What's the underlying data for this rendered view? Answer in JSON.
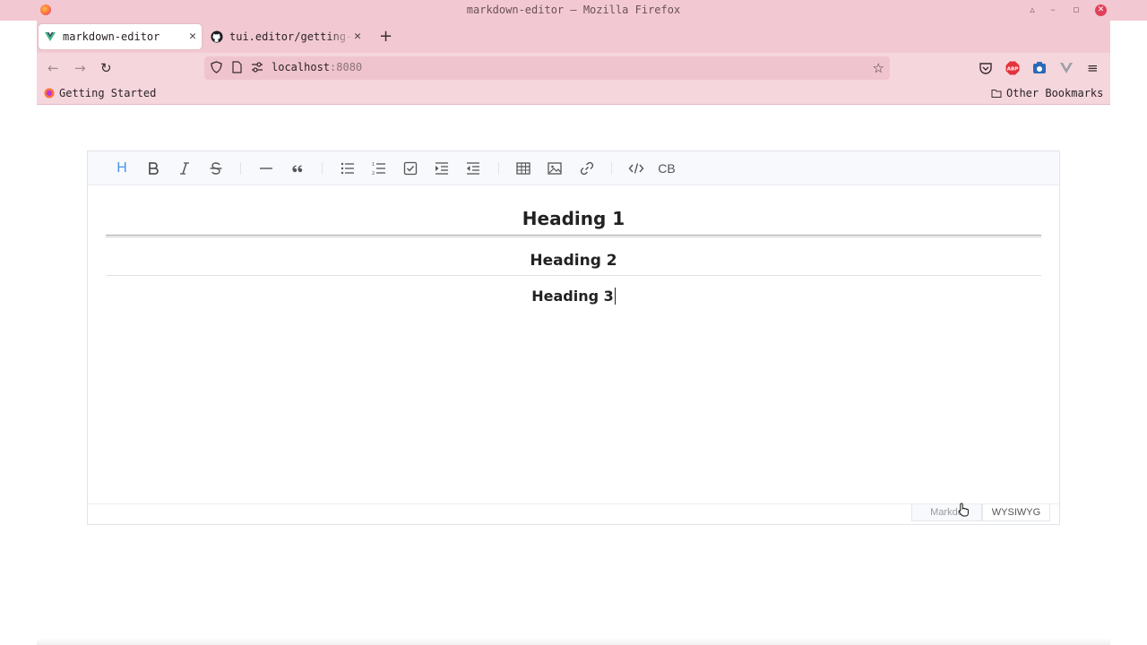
{
  "window": {
    "title": "markdown-editor — Mozilla Firefox"
  },
  "tabs": [
    {
      "label": "markdown-editor",
      "active": true,
      "favicon": "vue-icon"
    },
    {
      "label": "tui.editor/getting-started",
      "active": false,
      "favicon": "github-icon"
    }
  ],
  "navbar": {
    "url_host": "localhost",
    "url_port": ":8080"
  },
  "bookmarks": {
    "left": "Getting Started",
    "right": "Other Bookmarks"
  },
  "toolbar": {
    "items": [
      "heading",
      "bold",
      "italic",
      "strike",
      "hr",
      "quote",
      "ul",
      "ol",
      "task",
      "indent",
      "outdent",
      "table",
      "image",
      "link",
      "code",
      "codeblock"
    ],
    "codeblock_label": "CB",
    "accent_color": "#4b96e6"
  },
  "content": {
    "h1": "Heading 1",
    "h2": "Heading 2",
    "h3": "Heading 3"
  },
  "modes": {
    "markdown": "Markdo",
    "wysiwyg": "WYSIWYG",
    "active": "wysiwyg"
  }
}
